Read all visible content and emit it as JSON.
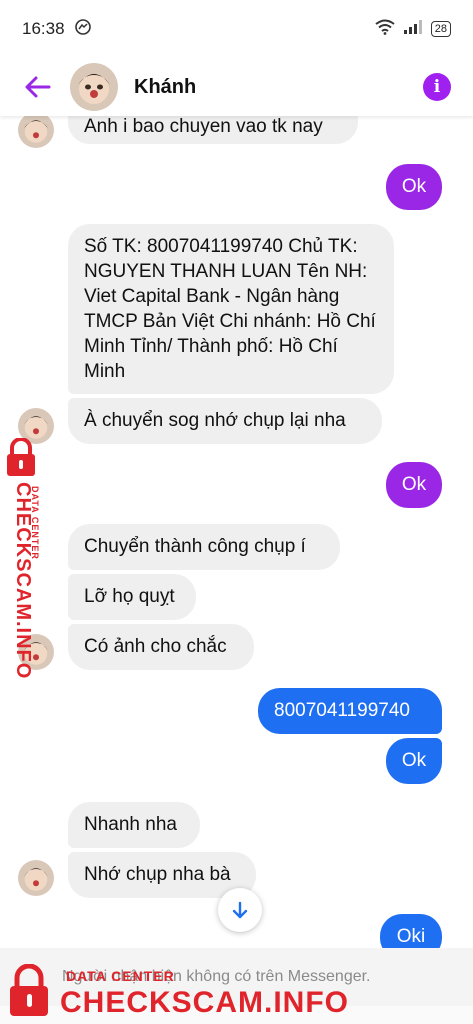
{
  "status": {
    "time": "16:38",
    "battery": "28"
  },
  "header": {
    "contact_name": "Khánh"
  },
  "messages": {
    "m1": "Anh i bao chuyen vao tk nay",
    "m2": "Ok",
    "m3": "Số TK: 8007041199740 Chủ TK: NGUYEN THANH LUAN Tên NH: Viet Capital Bank - Ngân hàng TMCP Bản Việt Chi nhánh: Hồ Chí Minh Tỉnh/ Thành phố: Hồ Chí Minh",
    "m4": "À chuyển sog nhớ chụp lại nha",
    "m5": "Ok",
    "m6": "Chuyển thành công chụp í",
    "m7": "Lỡ họ quỵt",
    "m8": "Có ảnh cho chắc",
    "m9": "8007041199740",
    "m10": "Ok",
    "m11": "Nhanh nha",
    "m12": "Nhớ chụp nha bà",
    "m13": "Oki"
  },
  "footer": {
    "notice": "Người nhận hiện không có trên Messenger."
  },
  "watermark": {
    "small": "DATA CENTER",
    "big": "CHECKSCAM.INFO"
  },
  "colors": {
    "accent": "#9b27e6",
    "blue": "#1f6ff2",
    "watermark": "#e0242b"
  }
}
